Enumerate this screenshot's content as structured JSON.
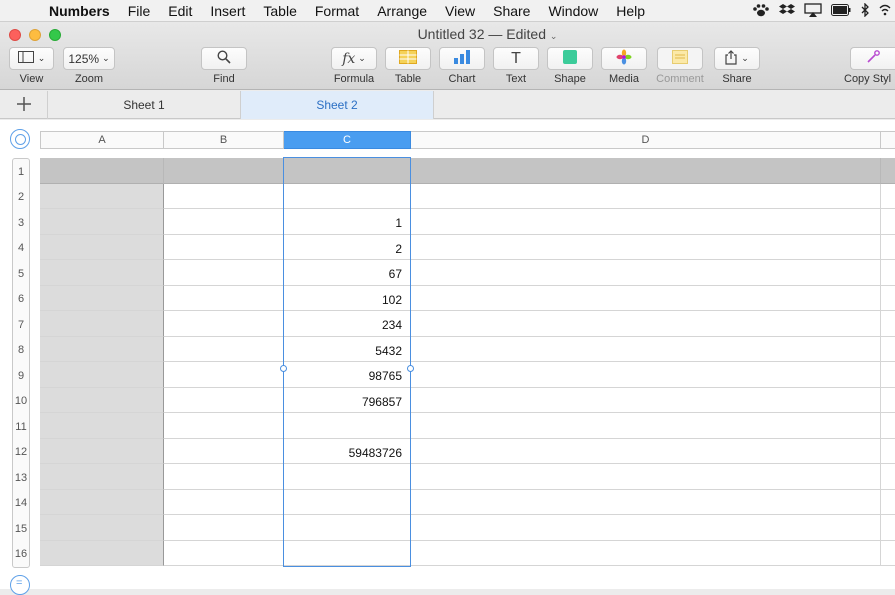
{
  "menubar": {
    "app_name": "Numbers",
    "items": [
      "File",
      "Edit",
      "Insert",
      "Table",
      "Format",
      "Arrange",
      "View",
      "Share",
      "Window",
      "Help"
    ],
    "status_icons": [
      "paw-icon",
      "dropbox-icon",
      "airplay-icon",
      "battery-icon",
      "bluetooth-icon",
      "wifi-icon"
    ]
  },
  "window": {
    "title": "Untitled 32",
    "subtitle": "— Edited"
  },
  "toolbar": {
    "view_label": "View",
    "zoom_value": "125%",
    "zoom_label": "Zoom",
    "find_label": "Find",
    "formula_label": "Formula",
    "formula_glyph": "fx",
    "table_label": "Table",
    "chart_label": "Chart",
    "text_label": "Text",
    "text_glyph": "T",
    "shape_label": "Shape",
    "media_label": "Media",
    "comment_label": "Comment",
    "share_label": "Share",
    "copy_style_label": "Copy Styl"
  },
  "tabs": {
    "sheets": [
      "Sheet 1",
      "Sheet 2"
    ],
    "active": "Sheet 2"
  },
  "table": {
    "columns": [
      "A",
      "B",
      "C",
      "D"
    ],
    "selected_column": "C",
    "rows": [
      "1",
      "2",
      "3",
      "4",
      "5",
      "6",
      "7",
      "8",
      "9",
      "10",
      "11",
      "12",
      "13",
      "14",
      "15",
      "16"
    ],
    "column_c_values": [
      "",
      "",
      "1",
      "2",
      "67",
      "102",
      "234",
      "5432",
      "98765",
      "796857",
      "",
      "59483726",
      "",
      "",
      "",
      ""
    ]
  },
  "colors": {
    "accent": "#4a9df0",
    "header_row": "#c4c4c4",
    "header_col": "#dcdcdc"
  }
}
